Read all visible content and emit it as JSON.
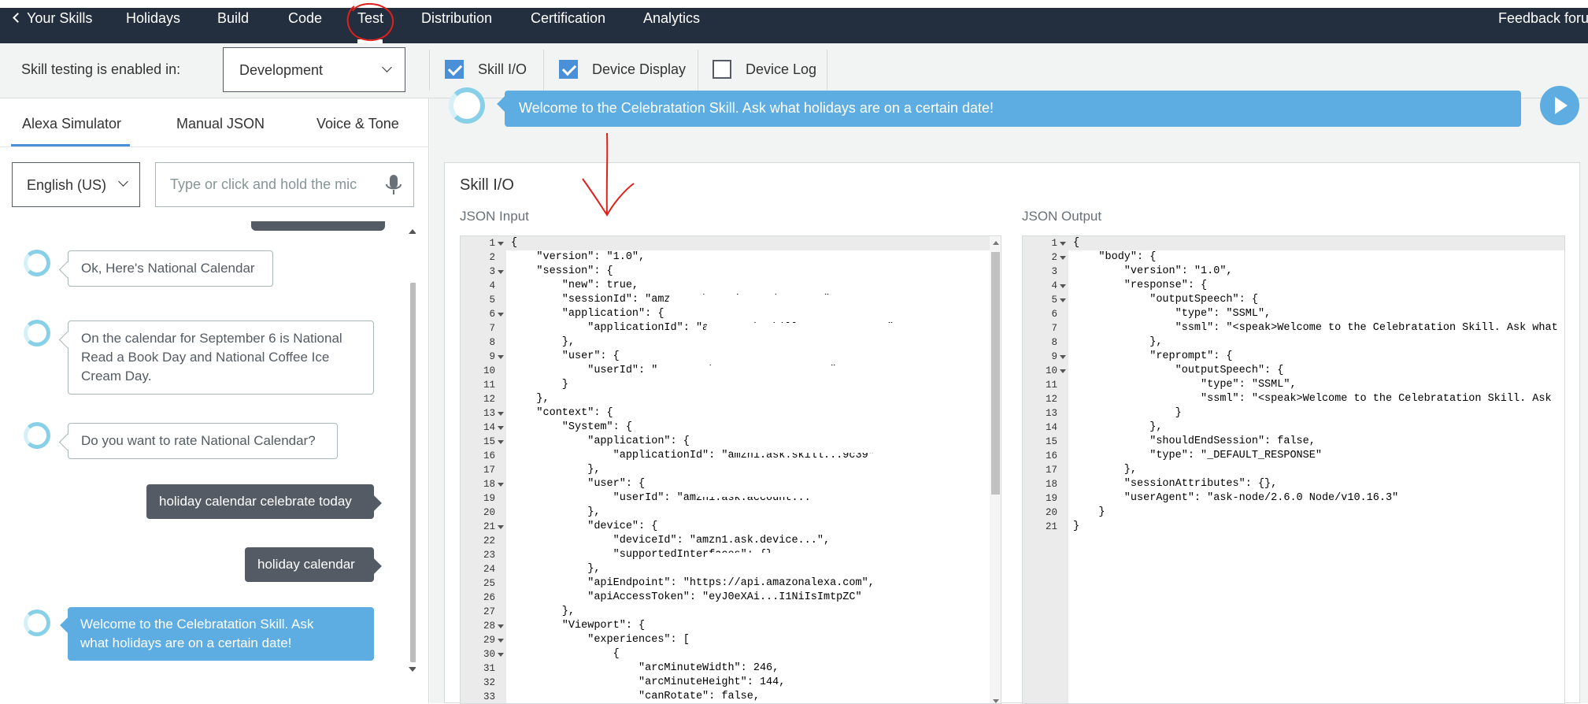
{
  "nav": {
    "back_label": "Your Skills",
    "items": [
      "Holidays",
      "Build",
      "Code",
      "Test",
      "Distribution",
      "Certification",
      "Analytics"
    ],
    "feedback_label": "Feedback forum"
  },
  "toolbar": {
    "testing_label": "Skill testing is enabled in:",
    "environment": "Development",
    "checkboxes": [
      {
        "label": "Skill I/O",
        "checked": true
      },
      {
        "label": "Device Display",
        "checked": true
      },
      {
        "label": "Device Log",
        "checked": false
      }
    ]
  },
  "simulator": {
    "tabs": [
      "Alexa Simulator",
      "Manual JSON",
      "Voice & Tone"
    ],
    "language": "English (US)",
    "input_placeholder": "Type or click and hold the mic",
    "messages": [
      {
        "from": "alexa",
        "text": "Ok, Here's National Calendar"
      },
      {
        "from": "alexa",
        "lines": [
          "On the calendar for September 6 is National",
          "Read a Book Day and National Coffee Ice",
          "Cream Day."
        ]
      },
      {
        "from": "alexa",
        "text": "Do you want to rate National Calendar?"
      },
      {
        "from": "user",
        "text": "holiday calendar celebrate today"
      },
      {
        "from": "user",
        "text": "holiday calendar"
      },
      {
        "from": "alexa",
        "lines": [
          "Welcome to the Celebratation Skill. Ask",
          "what holidays are on a certain date!"
        ]
      }
    ]
  },
  "display": {
    "text": "Welcome to the Celebratation Skill. Ask what holidays are on a certain date!"
  },
  "skill_io": {
    "title": "Skill I/O",
    "input_label": "JSON Input",
    "output_label": "JSON Output",
    "input_lines": [
      "{",
      "    \"version\": \"1.0\",",
      "    \"session\": {",
      "        \"new\": true,",
      "        \"sessionId\": \"amzn1.echo-api.session.c...\",",
      "        \"application\": {",
      "            \"applicationId\": \"amzn1.ask.skill.9c4...-0399-0\"",
      "        },",
      "        \"user\": {",
      "            \"userId\": \"amzn1.ask.account...7JSHOXW\"",
      "        }",
      "    },",
      "    \"context\": {",
      "        \"System\": {",
      "            \"application\": {",
      "                \"applicationId\": \"amzn1.ask.skill...9c39\"",
      "            },",
      "            \"user\": {",
      "                \"userId\": \"amzn1.ask.account...\"",
      "            },",
      "            \"device\": {",
      "                \"deviceId\": \"amzn1.ask.device...\",",
      "                \"supportedInterfaces\": {}",
      "            },",
      "            \"apiEndpoint\": \"https://api.amazonalexa.com\",",
      "            \"apiAccessToken\": \"eyJ0eXAi...I1NiIsImtpZC\"",
      "        },",
      "        \"Viewport\": {",
      "            \"experiences\": [",
      "                {",
      "                    \"arcMinuteWidth\": 246,",
      "                    \"arcMinuteHeight\": 144,",
      "                    \"canRotate\": false,"
    ],
    "output_lines": [
      "{",
      "    \"body\": {",
      "        \"version\": \"1.0\",",
      "        \"response\": {",
      "            \"outputSpeech\": {",
      "                \"type\": \"SSML\",",
      "                \"ssml\": \"<speak>Welcome to the Celebratation Skill. Ask what",
      "            },",
      "            \"reprompt\": {",
      "                \"outputSpeech\": {",
      "                    \"type\": \"SSML\",",
      "                    \"ssml\": \"<speak>Welcome to the Celebratation Skill. Ask",
      "                }",
      "            },",
      "            \"shouldEndSession\": false,",
      "            \"type\": \"_DEFAULT_RESPONSE\"",
      "        },",
      "        \"sessionAttributes\": {},",
      "        \"userAgent\": \"ask-node/2.6.0 Node/v10.16.3\"",
      "    }",
      "}"
    ],
    "input_folds": [
      1,
      3,
      6,
      9,
      13,
      14,
      15,
      18,
      21,
      28,
      29,
      30
    ],
    "output_folds": [
      1,
      2,
      4,
      5,
      9,
      10
    ]
  },
  "colors": {
    "nav_bg": "#232f3e",
    "accent": "#4a90d9",
    "alexa_bubble": "#5dade2",
    "user_bubble": "#545b64",
    "annotation": "#e0201b"
  }
}
